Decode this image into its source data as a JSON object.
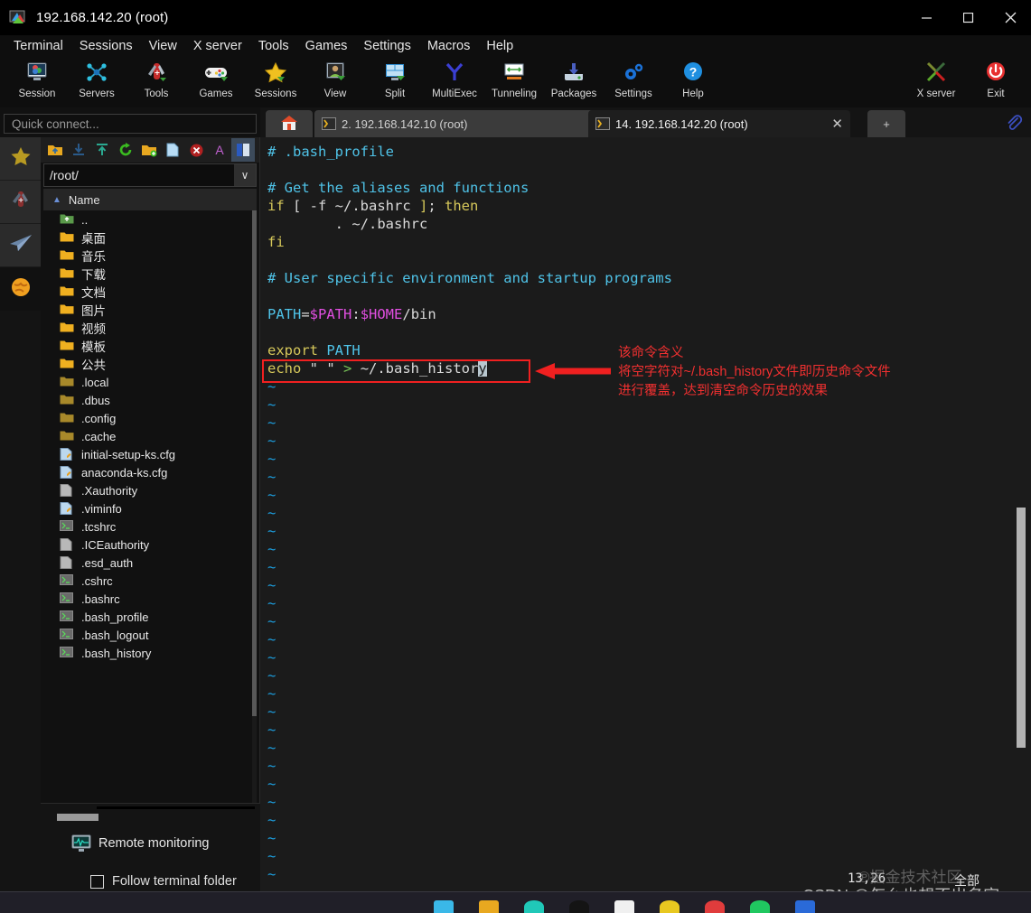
{
  "window": {
    "title": "192.168.142.20 (root)",
    "minimize": "─",
    "maximize": "□",
    "close": "✕"
  },
  "menu": {
    "items": [
      "Terminal",
      "Sessions",
      "View",
      "X server",
      "Tools",
      "Games",
      "Settings",
      "Macros",
      "Help"
    ]
  },
  "toolbar": {
    "items": [
      {
        "label": "Session",
        "icon": "session-icon"
      },
      {
        "label": "Servers",
        "icon": "servers-icon"
      },
      {
        "label": "Tools",
        "icon": "tools-icon"
      },
      {
        "label": "Games",
        "icon": "games-icon"
      },
      {
        "label": "Sessions",
        "icon": "sessions-star-icon"
      },
      {
        "label": "View",
        "icon": "view-icon"
      },
      {
        "label": "Split",
        "icon": "split-icon"
      },
      {
        "label": "MultiExec",
        "icon": "multiexec-icon"
      },
      {
        "label": "Tunneling",
        "icon": "tunneling-icon"
      },
      {
        "label": "Packages",
        "icon": "packages-icon"
      },
      {
        "label": "Settings",
        "icon": "settings-gear-icon"
      },
      {
        "label": "Help",
        "icon": "help-question-icon"
      }
    ],
    "right_items": [
      {
        "label": "X server",
        "icon": "x-server-icon"
      },
      {
        "label": "Exit",
        "icon": "exit-power-icon"
      }
    ]
  },
  "tabs": {
    "home_icon": "home-icon",
    "add_label": "+",
    "close_glyph": "✕",
    "items": [
      {
        "label": "2.  192.168.142.10 (root)",
        "active": false
      },
      {
        "label": "14.  192.168.142.20 (root)",
        "active": true
      }
    ]
  },
  "quick_connect": {
    "placeholder": "Quick connect..."
  },
  "sftp": {
    "path": "/root/",
    "column_header": "Name",
    "chevron": "∨",
    "sort_arrow": "▲",
    "toolbar_icons": [
      "go-up-folder-icon",
      "download-icon",
      "upload-icon",
      "refresh-icon",
      "new-folder-icon",
      "new-file-icon",
      "delete-icon",
      "text-edit-icon",
      "toggle-panel-icon"
    ],
    "entries": [
      {
        "name": "..",
        "type": "parent"
      },
      {
        "name": "桌面",
        "type": "folder"
      },
      {
        "name": "音乐",
        "type": "folder"
      },
      {
        "name": "下载",
        "type": "folder"
      },
      {
        "name": "文档",
        "type": "folder"
      },
      {
        "name": "图片",
        "type": "folder"
      },
      {
        "name": "视频",
        "type": "folder"
      },
      {
        "name": "模板",
        "type": "folder"
      },
      {
        "name": "公共",
        "type": "folder"
      },
      {
        "name": ".local",
        "type": "hidden-folder"
      },
      {
        "name": ".dbus",
        "type": "hidden-folder"
      },
      {
        "name": ".config",
        "type": "hidden-folder"
      },
      {
        "name": ".cache",
        "type": "hidden-folder"
      },
      {
        "name": "initial-setup-ks.cfg",
        "type": "text-file"
      },
      {
        "name": "anaconda-ks.cfg",
        "type": "text-file"
      },
      {
        "name": ".Xauthority",
        "type": "file"
      },
      {
        "name": ".viminfo",
        "type": "text-file"
      },
      {
        "name": ".tcshrc",
        "type": "script-file"
      },
      {
        "name": ".ICEauthority",
        "type": "file"
      },
      {
        "name": ".esd_auth",
        "type": "file"
      },
      {
        "name": ".cshrc",
        "type": "script-file"
      },
      {
        "name": ".bashrc",
        "type": "script-file"
      },
      {
        "name": ".bash_profile",
        "type": "script-file"
      },
      {
        "name": ".bash_logout",
        "type": "script-file"
      },
      {
        "name": ".bash_history",
        "type": "script-file"
      }
    ],
    "remote_monitoring": "Remote monitoring",
    "follow_terminal_folder": "Follow terminal folder"
  },
  "terminal": {
    "lines": [
      [
        {
          "t": "# .bash_profile",
          "c": "cyan"
        }
      ],
      [],
      [
        {
          "t": "# Get the aliases and functions",
          "c": "cyan"
        }
      ],
      [
        {
          "t": "if",
          "c": "yellow"
        },
        {
          "t": " [ ",
          "c": "white"
        },
        {
          "t": "-f",
          "c": "white"
        },
        {
          "t": " ~/.bashrc ",
          "c": "white"
        },
        {
          "t": "]",
          "c": "yellow"
        },
        {
          "t": "; ",
          "c": "white"
        },
        {
          "t": "then",
          "c": "yellow"
        }
      ],
      [
        {
          "t": "        . ~/.bashrc",
          "c": "white"
        }
      ],
      [
        {
          "t": "fi",
          "c": "yellow"
        }
      ],
      [],
      [
        {
          "t": "# User specific environment and startup programs",
          "c": "cyan"
        }
      ],
      [],
      [
        {
          "t": "PATH",
          "c": "cyan"
        },
        {
          "t": "=",
          "c": "white"
        },
        {
          "t": "$PATH",
          "c": "magenta"
        },
        {
          "t": ":",
          "c": "white"
        },
        {
          "t": "$HOME",
          "c": "magenta"
        },
        {
          "t": "/bin",
          "c": "white"
        }
      ],
      [],
      [
        {
          "t": "export",
          "c": "yellow"
        },
        {
          "t": " ",
          "c": "white"
        },
        {
          "t": "PATH",
          "c": "cyan"
        }
      ],
      [
        {
          "t": "echo",
          "c": "yellow"
        },
        {
          "t": " ",
          "c": "white"
        },
        {
          "t": "\" \"",
          "c": "white"
        },
        {
          "t": " ",
          "c": "white"
        },
        {
          "t": ">",
          "c": "green"
        },
        {
          "t": " ~/.bash_histor",
          "c": "white"
        },
        {
          "t": "y",
          "c": "cursor"
        }
      ]
    ],
    "tilde": "~",
    "tilde_count": 29,
    "status_position": "13,26",
    "status_scope": "全部"
  },
  "annotation": {
    "color": "#f23030",
    "lines": [
      "该命令含义",
      "将空字符对~/.bash_history文件即历史命令文件",
      "进行覆盖，达到清空命令历史的效果"
    ]
  },
  "watermark": {
    "line1": "℗掘金技术社区",
    "line2": "CSDN @怎么也想不出名字"
  }
}
